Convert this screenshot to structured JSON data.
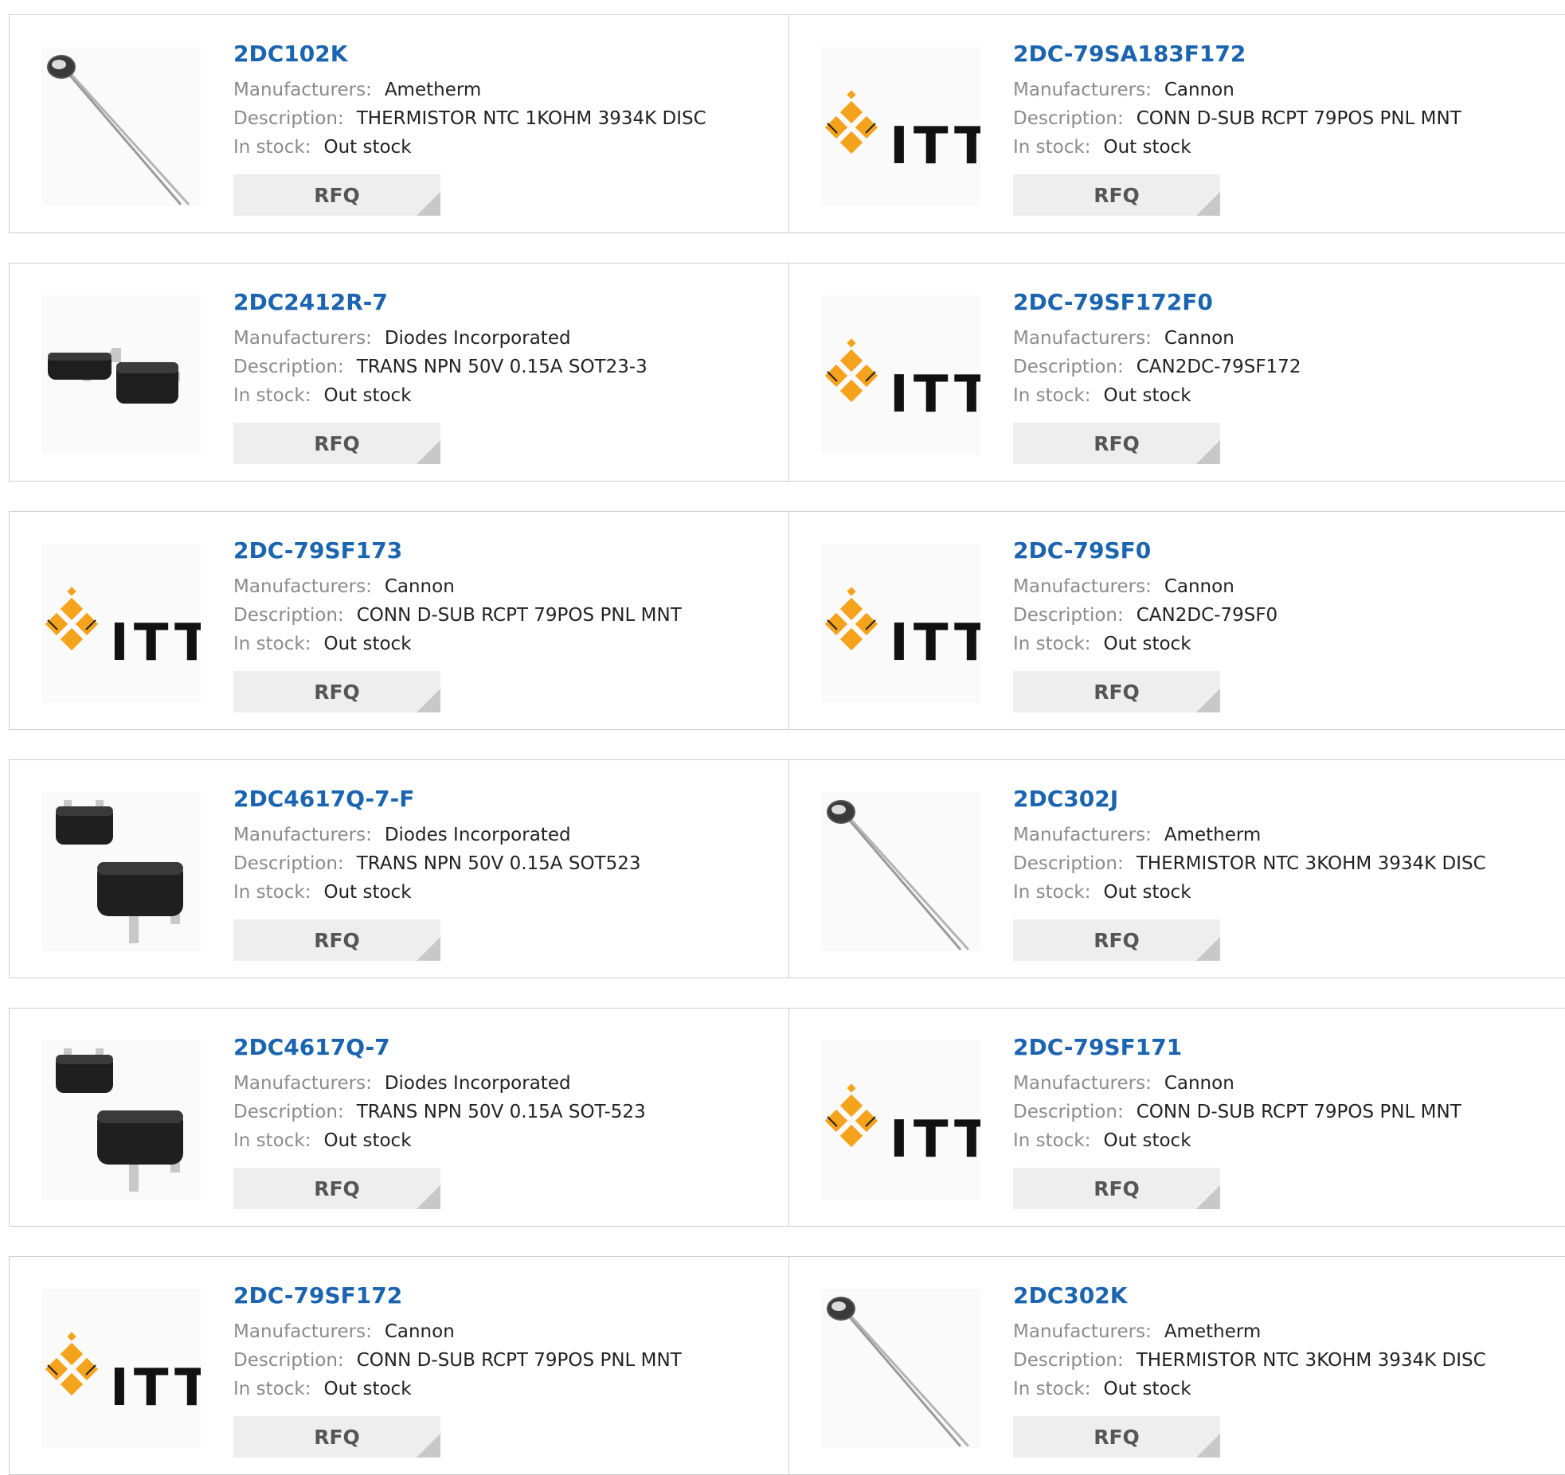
{
  "labels": {
    "manufacturers": "Manufacturers:",
    "description": "Description:",
    "in_stock": "In stock:",
    "rfq": "RFQ"
  },
  "colors": {
    "link": "#1a64b0",
    "label": "#8b8b8b",
    "rfq_bg": "#eeeeee",
    "itt_orange": "#f5a21c"
  },
  "products": [
    {
      "part": "2DC102K",
      "manufacturer": "Ametherm",
      "description": "THERMISTOR NTC 1KOHM 3934K DISC",
      "stock": "Out stock",
      "image": "thermistor-image"
    },
    {
      "part": "2DC-79SA183F172",
      "manufacturer": "Cannon",
      "description": "CONN D-SUB RCPT 79POS PNL MNT",
      "stock": "Out stock",
      "image": "itt-logo"
    },
    {
      "part": "2DC2412R-7",
      "manufacturer": "Diodes Incorporated",
      "description": "TRANS NPN 50V 0.15A SOT23-3",
      "stock": "Out stock",
      "image": "sot23-image"
    },
    {
      "part": "2DC-79SF172F0",
      "manufacturer": "Cannon",
      "description": "CAN2DC-79SF172",
      "stock": "Out stock",
      "image": "itt-logo"
    },
    {
      "part": "2DC-79SF173",
      "manufacturer": "Cannon",
      "description": "CONN D-SUB RCPT 79POS PNL MNT",
      "stock": "Out stock",
      "image": "itt-logo"
    },
    {
      "part": "2DC-79SF0",
      "manufacturer": "Cannon",
      "description": "CAN2DC-79SF0",
      "stock": "Out stock",
      "image": "itt-logo"
    },
    {
      "part": "2DC4617Q-7-F",
      "manufacturer": "Diodes Incorporated",
      "description": "TRANS NPN 50V 0.15A SOT523",
      "stock": "Out stock",
      "image": "sot523-image"
    },
    {
      "part": "2DC302J",
      "manufacturer": "Ametherm",
      "description": "THERMISTOR NTC 3KOHM 3934K DISC",
      "stock": "Out stock",
      "image": "thermistor-image"
    },
    {
      "part": "2DC4617Q-7",
      "manufacturer": "Diodes Incorporated",
      "description": "TRANS NPN 50V 0.15A SOT-523",
      "stock": "Out stock",
      "image": "sot523-image"
    },
    {
      "part": "2DC-79SF171",
      "manufacturer": "Cannon",
      "description": "CONN D-SUB RCPT 79POS PNL MNT",
      "stock": "Out stock",
      "image": "itt-logo"
    },
    {
      "part": "2DC-79SF172",
      "manufacturer": "Cannon",
      "description": "CONN D-SUB RCPT 79POS PNL MNT",
      "stock": "Out stock",
      "image": "itt-logo"
    },
    {
      "part": "2DC302K",
      "manufacturer": "Ametherm",
      "description": "THERMISTOR NTC 3KOHM 3934K DISC",
      "stock": "Out stock",
      "image": "thermistor-image"
    }
  ]
}
